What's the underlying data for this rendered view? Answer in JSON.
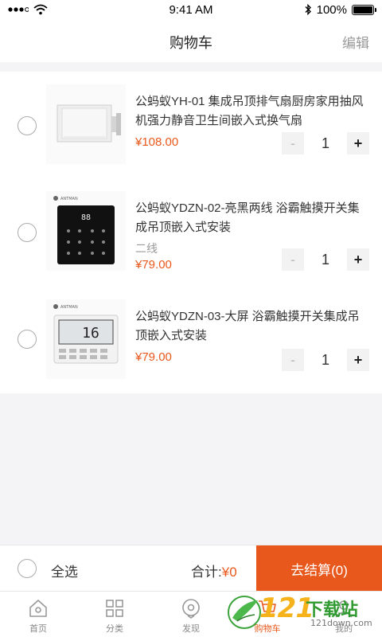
{
  "status_bar": {
    "time": "9:41 AM",
    "battery": "100%",
    "battery_level": 1.0
  },
  "nav": {
    "title": "购物车",
    "edit": "编辑"
  },
  "items": [
    {
      "title": "公蚂蚁YH-01 集成吊顶排气扇厨房家用抽风机强力静音卫生间嵌入式换气扇",
      "spec": "",
      "price": "¥108.00",
      "qty": "1",
      "image": "exhaust-fan"
    },
    {
      "title": "公蚂蚁YDZN-02-亮黑两线 浴霸触摸开关集成吊顶嵌入式安装",
      "spec": "二线",
      "price": "¥79.00",
      "qty": "1",
      "image": "black-touch-switch",
      "image_text": {
        "brand": "ANTMAN",
        "display": "88"
      }
    },
    {
      "title": "公蚂蚁YDZN-03-大屏 浴霸触摸开关集成吊顶嵌入式安装",
      "spec": "",
      "price": "¥79.00",
      "qty": "1",
      "image": "white-lcd-switch",
      "image_text": {
        "brand": "ANTMAN",
        "display": "16"
      }
    }
  ],
  "stepper": {
    "minus": "-",
    "plus": "+"
  },
  "checkout": {
    "select_all": "全选",
    "total_label": "合计:",
    "total_amount": "¥0",
    "button": "去结算(0)"
  },
  "tabs": [
    {
      "label": "首页",
      "icon": "home-icon"
    },
    {
      "label": "分类",
      "icon": "grid-icon"
    },
    {
      "label": "发现",
      "icon": "compass-icon"
    },
    {
      "label": "购物车",
      "icon": "cart-icon",
      "active": true
    },
    {
      "label": "我的",
      "icon": "user-icon"
    }
  ],
  "watermark": {
    "number": "121",
    "name": "下载站",
    "domain": "121down.com"
  },
  "colors": {
    "accent": "#e8581c",
    "background": "#f4f4f6"
  }
}
